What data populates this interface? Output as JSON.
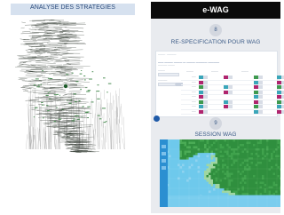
{
  "left_panel": {
    "title": "ANALYSE DES STRATEGIES"
  },
  "app": {
    "title": "e-WAG"
  },
  "step8": {
    "number": "8",
    "title": "RE-SPECIFICATION POUR WAG"
  },
  "step9": {
    "number": "9",
    "title": "SESSION WAG"
  },
  "colors": {
    "accent": "#1f5aa8",
    "header": "#0b0b0b",
    "panel": "#e9ebef",
    "toggle_teal": "#3aa6b9",
    "toggle_magenta": "#b0246e",
    "toggle_green": "#3e9a4f",
    "map_water": "#6ec9ec",
    "map_land": "#2f8f3e",
    "map_deep": "#2b8fd1"
  }
}
